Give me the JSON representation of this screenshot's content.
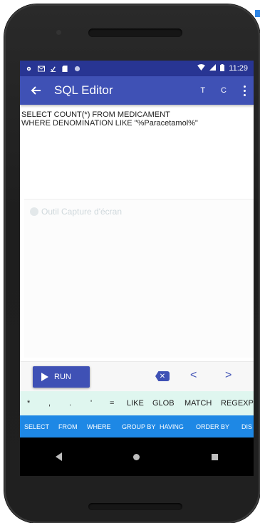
{
  "status_bar": {
    "time": "11:29"
  },
  "app_bar": {
    "title": "SQL Editor",
    "action_t": "T",
    "action_c": "C"
  },
  "editor": {
    "query_line_1": "SELECT COUNT(*) FROM MEDICAMENT",
    "query_line_2": "WHERE DENOMINATION LIKE \"%Paracetamol%\""
  },
  "overlay": {
    "label": "Outil Capture d'écran"
  },
  "controls": {
    "run_label": "RUN",
    "prev_label": "<",
    "next_label": ">",
    "delete_symbol": "✕"
  },
  "symbols": [
    "*",
    ",",
    ".",
    "'",
    "=",
    "LIKE",
    "GLOB",
    "MATCH",
    "REGEXP"
  ],
  "keywords": [
    "SELECT",
    "FROM",
    "WHERE",
    "GROUP BY",
    "HAVING",
    "ORDER BY",
    "DIS"
  ],
  "colors": {
    "primary": "#3f51b5",
    "status_bar": "#283593",
    "keyword_bar": "#1e88e5",
    "symbol_bar": "#dff6ef"
  }
}
